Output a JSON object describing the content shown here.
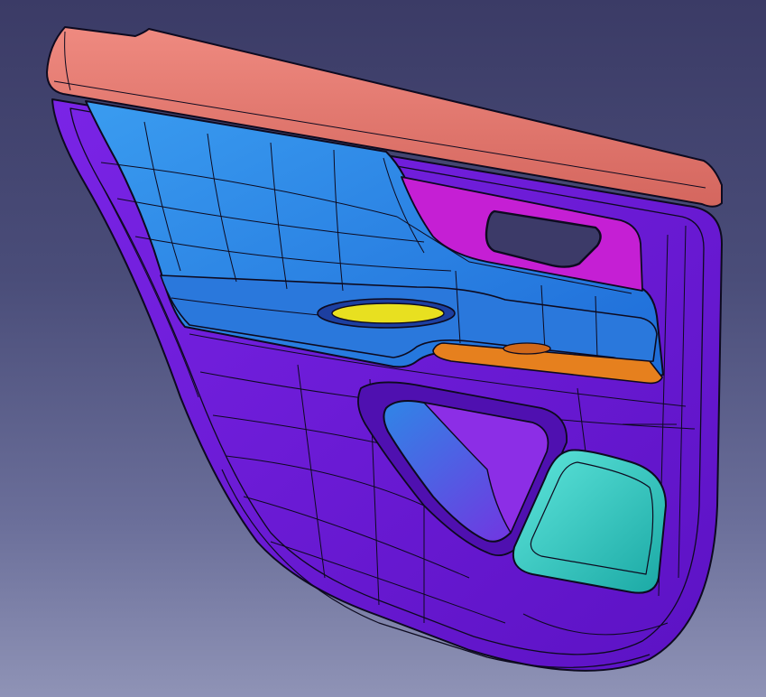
{
  "viewport": {
    "background_top": "#3b3b66",
    "background_bottom": "#8f93b6"
  },
  "model": {
    "part": "door-trim-panel",
    "colors": {
      "carrier": "#6a19d6",
      "carrier_dark": "#4f10b0",
      "belt_rail": "#e07870",
      "upper_insert": "#2f8ae8",
      "armrest": "#2a78dc",
      "handle_bezel": "#c51fd4",
      "pull_cup": "#e8e020",
      "switch_strip": "#e6801e",
      "speaker_grille": "#24c8c0",
      "map_pocket": "#3a6fd8",
      "edge": "#0d0a1f"
    }
  }
}
